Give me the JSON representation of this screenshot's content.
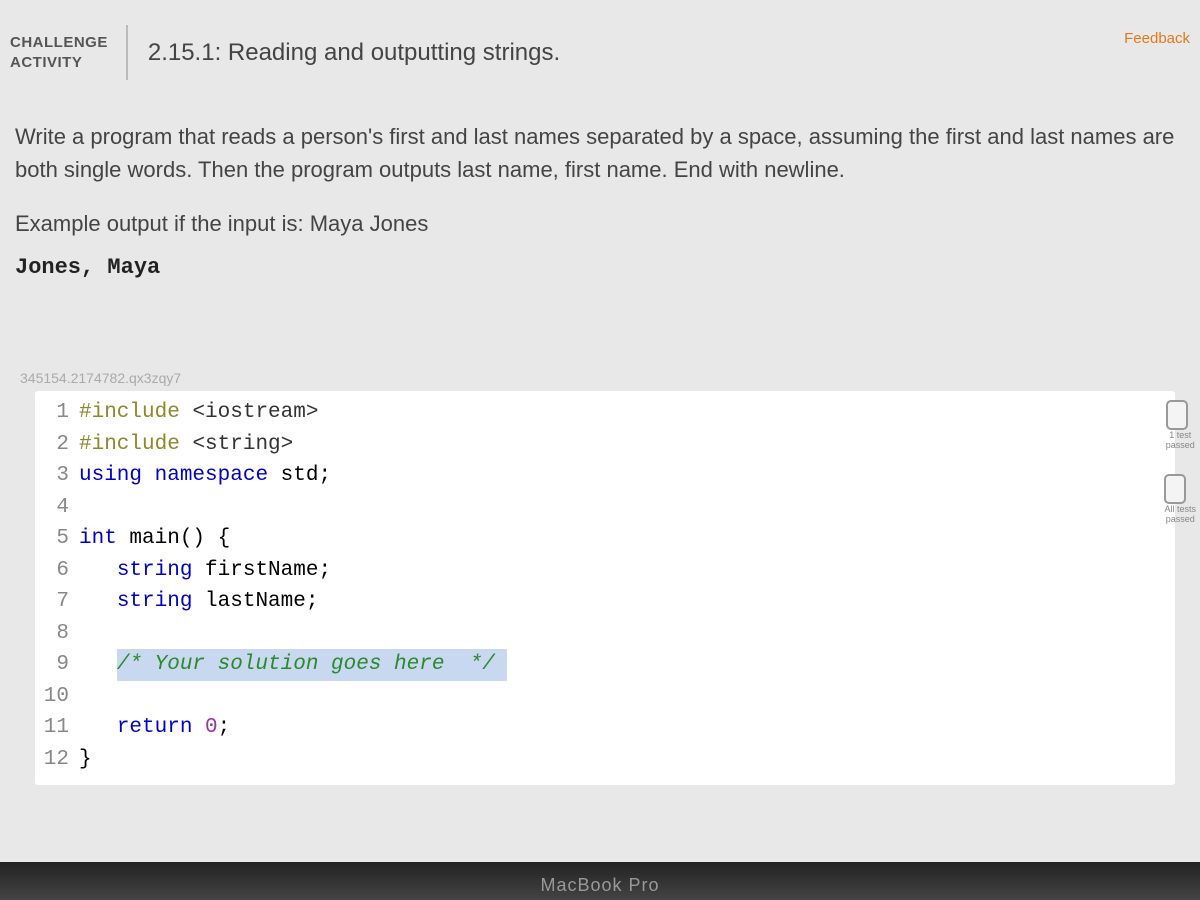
{
  "feedback": "Feedback",
  "challenge_label_line1": "CHALLENGE",
  "challenge_label_line2": "ACTIVITY",
  "activity_title": "2.15.1: Reading and outputting strings.",
  "instructions": "Write a program that reads a person's first and last names separated by a space, assuming the first and last names are both single words. Then the program outputs last name, first name. End with newline.",
  "example_label": "Example output if the input is: Maya Jones",
  "example_output": "Jones, Maya",
  "watermark": "345154.2174782.qx3zqy7",
  "code_lines": [
    {
      "num": "1",
      "html": "<span class='k-pre'>#include</span> <span class='k-include-target'>&lt;iostream&gt;</span>"
    },
    {
      "num": "2",
      "html": "<span class='k-pre'>#include</span> <span class='k-include-target'>&lt;string&gt;</span>"
    },
    {
      "num": "3",
      "html": "<span class='k-keyword'>using</span> <span class='k-keyword'>namespace</span> std;"
    },
    {
      "num": "4",
      "html": ""
    },
    {
      "num": "5",
      "html": "<span class='k-type'>int</span> main() {"
    },
    {
      "num": "6",
      "html": "   <span class='k-type'>string</span> firstName;"
    },
    {
      "num": "7",
      "html": "   <span class='k-type'>string</span> lastName;"
    },
    {
      "num": "8",
      "html": ""
    },
    {
      "num": "9",
      "html": "   <span class='highlight-line'><span class='k-comment'>/* Your solution goes here  */</span></span>"
    },
    {
      "num": "10",
      "html": ""
    },
    {
      "num": "11",
      "html": "   <span class='k-keyword'>return</span> <span class='k-num'>0</span>;"
    },
    {
      "num": "12",
      "html": "}"
    }
  ],
  "macbook_text": "MacBook Pro"
}
